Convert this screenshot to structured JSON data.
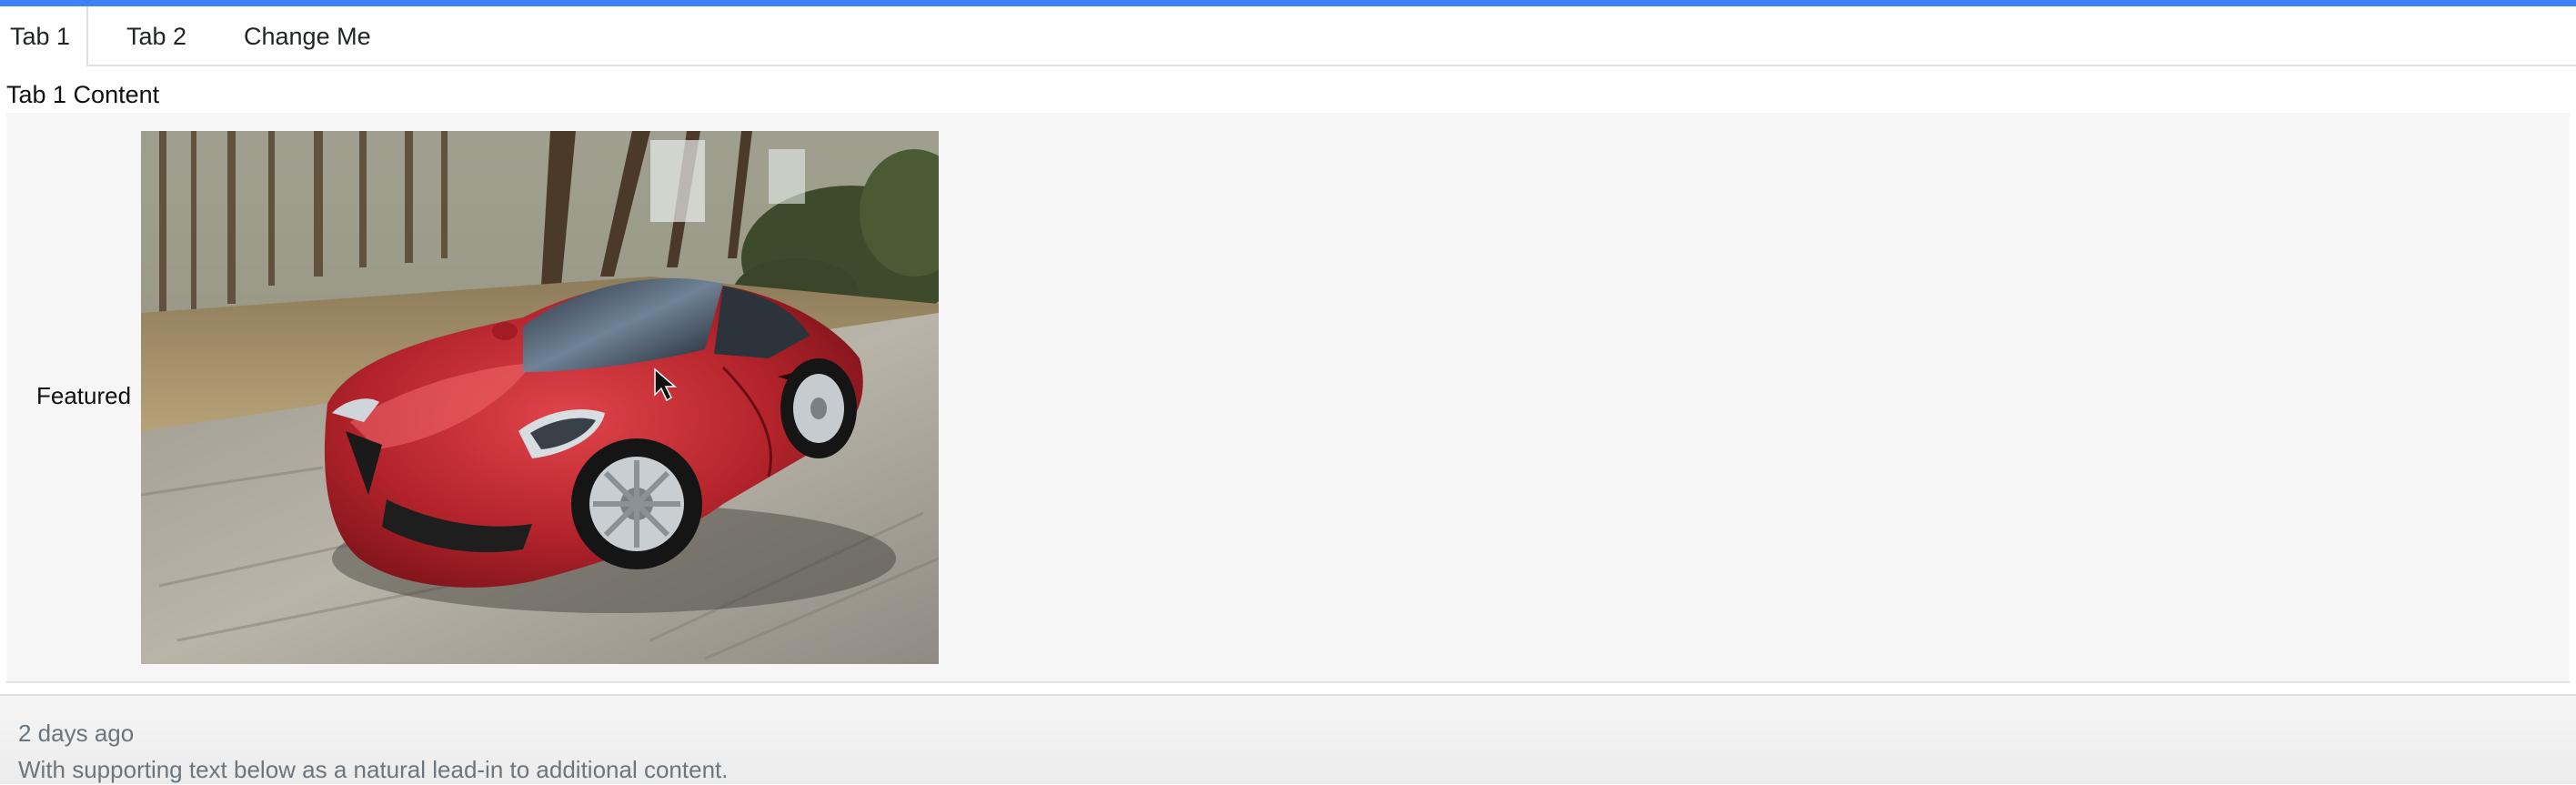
{
  "tabs": [
    {
      "label": "Tab 1",
      "active": true
    },
    {
      "label": "Tab 2",
      "active": false
    },
    {
      "label": "Change Me",
      "active": false
    }
  ],
  "content": {
    "title": "Tab 1 Content",
    "featured_label": "Featured",
    "image_icon": "car-photo"
  },
  "footer": {
    "time": "2 days ago",
    "text": "With supporting text below as a natural lead-in to additional content."
  },
  "colors": {
    "accent": "#3b82f6",
    "panel_bg": "#f6f6f6",
    "muted_text": "#6c757d",
    "car_red": "#b3232b"
  }
}
